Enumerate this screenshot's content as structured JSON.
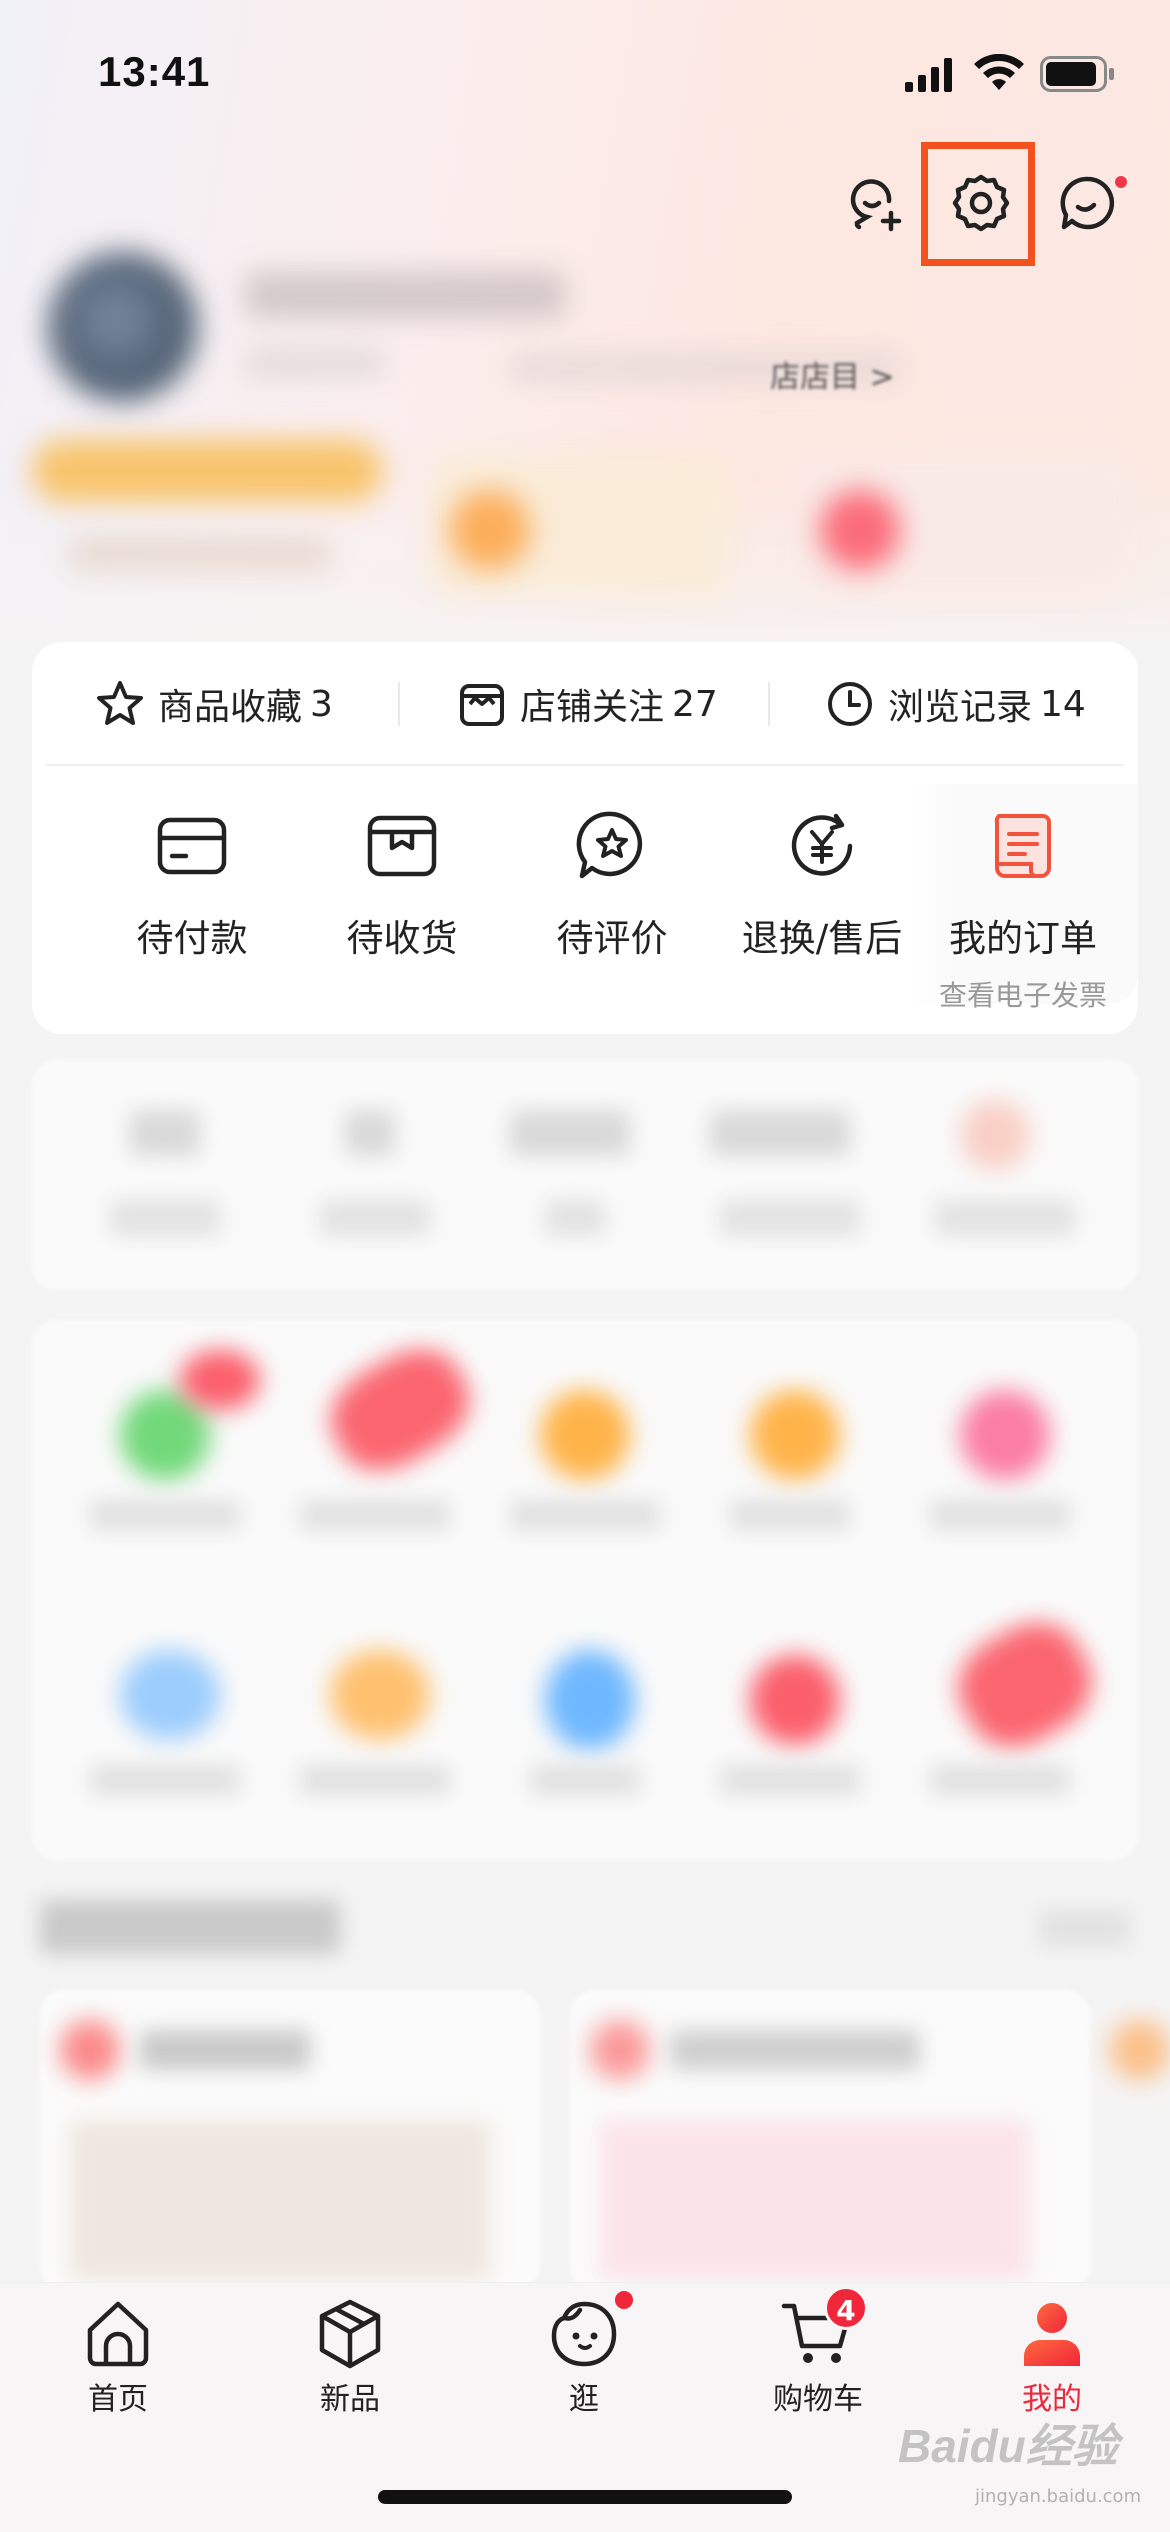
{
  "status_bar": {
    "time": "13:41"
  },
  "header": {
    "icons": [
      "add-friend-icon",
      "settings-icon",
      "message-icon"
    ],
    "highlight_color": "#f2521d",
    "partial_text": "店店目 >"
  },
  "stats": [
    {
      "label": "商品收藏",
      "count": "3"
    },
    {
      "label": "店铺关注",
      "count": "27"
    },
    {
      "label": "浏览记录",
      "count": "14"
    }
  ],
  "orders": [
    {
      "label": "待付款",
      "icon": "card-icon"
    },
    {
      "label": "待收货",
      "icon": "box-icon"
    },
    {
      "label": "待评价",
      "icon": "review-star-icon"
    },
    {
      "label": "退换/售后",
      "icon": "refund-yuan-icon"
    },
    {
      "label": "我的订单",
      "sub": "查看电子发票",
      "icon": "order-receipt-icon"
    }
  ],
  "tabbar": {
    "items": [
      {
        "label": "首页",
        "icon": "home-icon"
      },
      {
        "label": "新品",
        "icon": "cube-icon"
      },
      {
        "label": "逛",
        "icon": "stroll-face-icon"
      },
      {
        "label": "购物车",
        "icon": "cart-icon",
        "badge": "4"
      },
      {
        "label": "我的",
        "icon": "person-icon",
        "active": true
      }
    ],
    "active_color": "#f0263b"
  },
  "watermark": {
    "text": "Baidu经验",
    "sub": "jingyan.baidu.com"
  }
}
